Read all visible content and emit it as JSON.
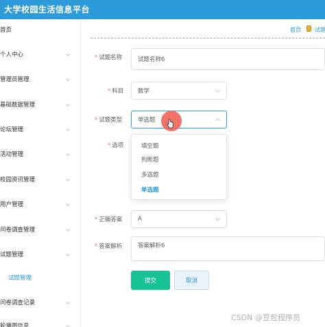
{
  "app": {
    "title": "大学校园生活信息平台"
  },
  "sidebar": {
    "items": [
      {
        "label": "首页",
        "expandable": false
      },
      {
        "label": "个人中心",
        "expandable": true
      },
      {
        "label": "管理员管理",
        "expandable": true
      },
      {
        "label": "基础数据管理",
        "expandable": true
      },
      {
        "label": "论坛管理",
        "expandable": true
      },
      {
        "label": "活动管理",
        "expandable": true
      },
      {
        "label": "校园资讯管理",
        "expandable": true
      },
      {
        "label": "用户管理",
        "expandable": true
      },
      {
        "label": "问卷调查管理",
        "expandable": true
      },
      {
        "label": "试题管理",
        "expandable": true
      },
      {
        "label": "试题管理",
        "expandable": false,
        "active": true
      },
      {
        "label": "问卷调查记录",
        "expandable": true
      },
      {
        "label": "轮播图信息",
        "expandable": true
      }
    ]
  },
  "breadcrumb": {
    "home": "首页",
    "current": "试题"
  },
  "form": {
    "name": {
      "label": "试题名称",
      "value": "试题名称6",
      "required": true
    },
    "subject": {
      "label": "科目",
      "value": "数学",
      "required": true
    },
    "type": {
      "label": "试题类型",
      "value": "单选题",
      "required": true
    },
    "options": {
      "label": "选项",
      "required": true
    },
    "answer": {
      "label": "正确答案",
      "value": "A",
      "required": true
    },
    "analysis": {
      "label": "答案解析",
      "value": "答案解析6",
      "required": true
    }
  },
  "type_dropdown": {
    "options": [
      "填空题",
      "判断题",
      "多选题",
      "单选题"
    ],
    "selected": "单选题"
  },
  "actions": {
    "submit": "提交",
    "cancel": "取消"
  },
  "watermark": "CSDN @豆包程序员",
  "colors": {
    "header": "#2d9ad9",
    "primary_button": "#19c295",
    "accent": "#2d9ad9"
  }
}
